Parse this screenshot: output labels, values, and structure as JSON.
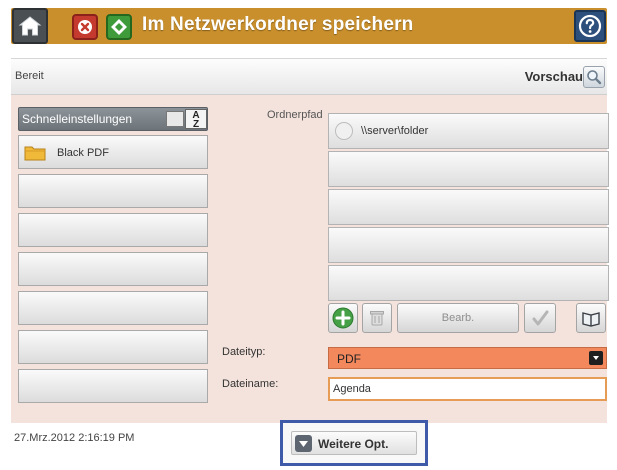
{
  "header": {
    "title": "Im Netzwerkordner speichern",
    "icons": {
      "home": "home-icon",
      "stop": "stop-icon",
      "start": "start-icon",
      "help": "help-icon"
    },
    "colors": {
      "bar": "#c98f2c",
      "stop": "#c43a2f",
      "start": "#3f9a3a",
      "help": "#2c4f7c"
    }
  },
  "status": {
    "text": "Bereit",
    "preview_label": "Vorschau",
    "preview_icon": "magnifier-icon"
  },
  "quick_settings": {
    "header": "Schnelleinstellungen",
    "sort_label": "A\nZ",
    "items": [
      {
        "label": "Black PDF"
      },
      {
        "label": ""
      },
      {
        "label": ""
      },
      {
        "label": ""
      },
      {
        "label": ""
      },
      {
        "label": ""
      },
      {
        "label": ""
      }
    ]
  },
  "folder": {
    "path_label": "Ordnerpfad",
    "paths": [
      {
        "text": "\\\\server\\folder"
      },
      {
        "text": ""
      },
      {
        "text": ""
      },
      {
        "text": ""
      },
      {
        "text": ""
      }
    ],
    "edit_label": "Bearb.",
    "toolbar_icons": [
      "add-icon",
      "delete-icon",
      "check-icon",
      "address-book-icon"
    ]
  },
  "file": {
    "type_label": "Dateityp:",
    "type_value": "PDF",
    "name_label": "Dateiname:",
    "name_value": "Agenda"
  },
  "footer": {
    "datetime": "27.Mrz.2012 2:16:19 PM",
    "more_label": "Weitere Opt.",
    "more_icon": "chevron-down-icon"
  }
}
